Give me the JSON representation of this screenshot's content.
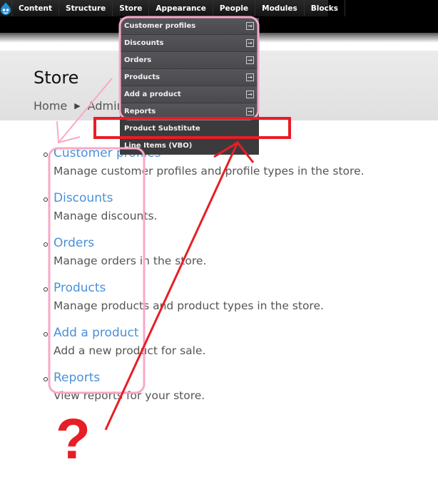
{
  "toolbar": {
    "logo_icon": "drupal-drop-icon",
    "items": [
      "Content",
      "Structure",
      "Store",
      "Appearance",
      "People",
      "Modules",
      "Blocks"
    ]
  },
  "header": {
    "title": "Store",
    "breadcrumb": [
      "Home",
      "Administration"
    ]
  },
  "store_menu": {
    "items": [
      {
        "label": "Customer profiles",
        "has_submenu": true
      },
      {
        "label": "Discounts",
        "has_submenu": true
      },
      {
        "label": "Orders",
        "has_submenu": true
      },
      {
        "label": "Products",
        "has_submenu": true
      },
      {
        "label": "Add a product",
        "has_submenu": true
      },
      {
        "label": "Reports",
        "has_submenu": true
      },
      {
        "label": "Product Substitute",
        "has_submenu": false
      },
      {
        "label": "Line Items (VBO)",
        "has_submenu": false
      }
    ]
  },
  "admin_list": [
    {
      "title": "Customer profiles",
      "description": "Manage customer profiles and profile types in the store."
    },
    {
      "title": "Discounts",
      "description": "Manage discounts."
    },
    {
      "title": "Orders",
      "description": "Manage orders in the store."
    },
    {
      "title": "Products",
      "description": "Manage products and product types in the store."
    },
    {
      "title": "Add a product",
      "description": "Add a new product for sale."
    },
    {
      "title": "Reports",
      "description": "View reports for your store."
    }
  ],
  "annotation": {
    "question_mark": "?",
    "pink": "#f9a8c8",
    "red": "#e61e25"
  }
}
